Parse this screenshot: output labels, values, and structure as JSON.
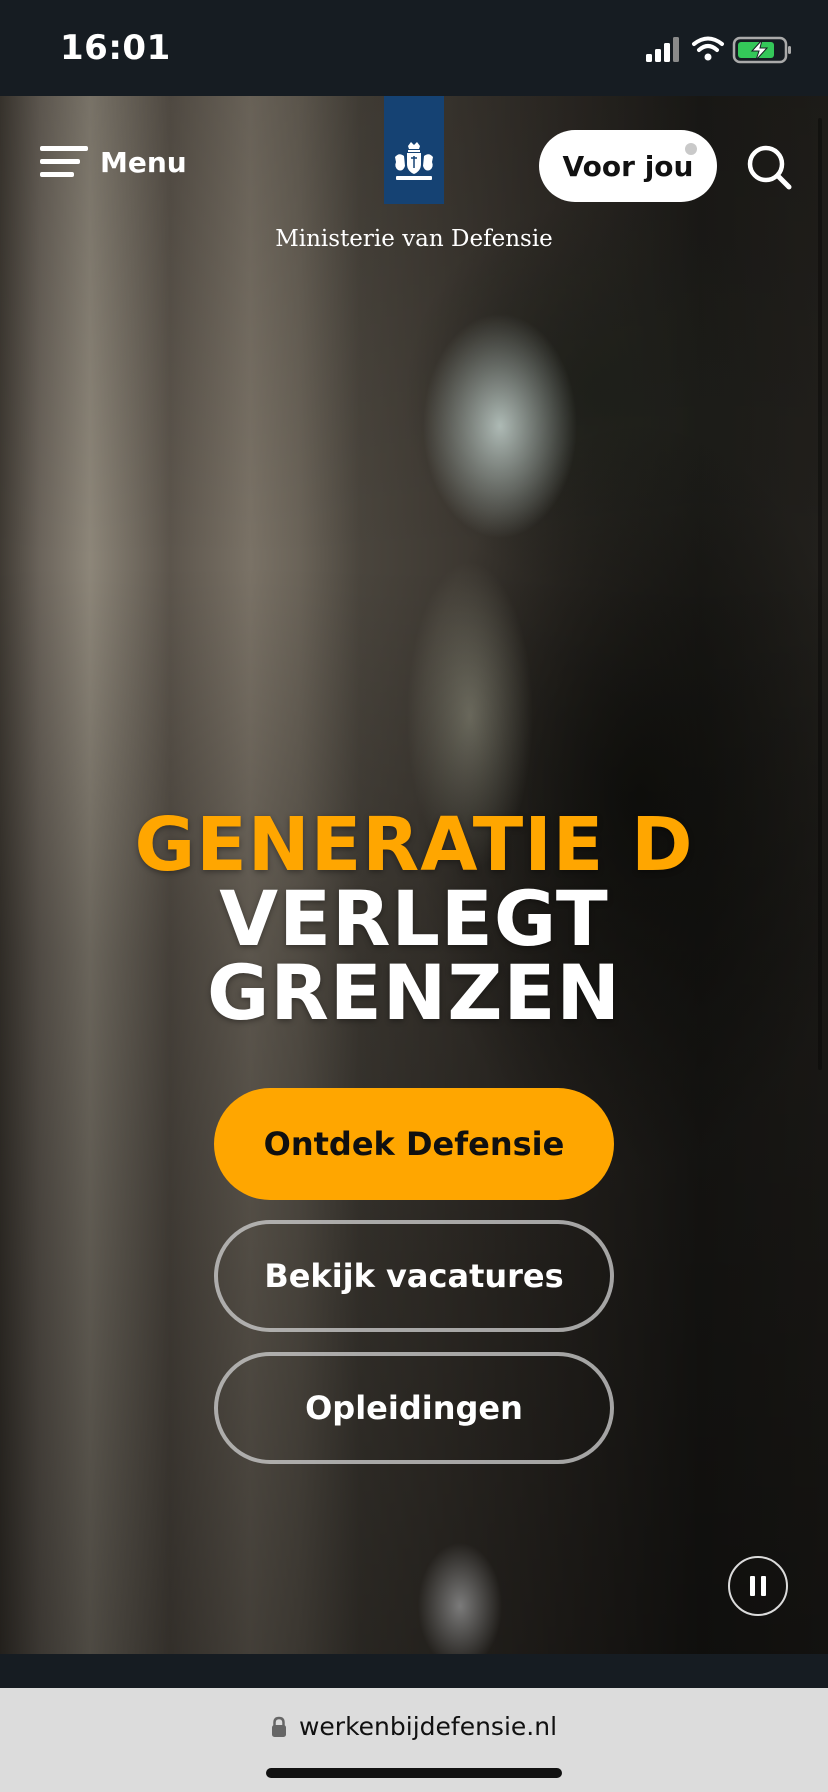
{
  "status_bar": {
    "time": "16:01",
    "icons": [
      "signal-icon",
      "wifi-icon",
      "battery-charging-icon"
    ]
  },
  "header": {
    "menu_label": "Menu",
    "logo_icon": "rijksoverheid-coat-of-arms-logo",
    "ministry_name": "Ministerie van Defensie",
    "voor_jou_label": "Voor jou",
    "search_icon": "search-icon"
  },
  "hero": {
    "headline_line1": "GENERATIE D",
    "headline_line2": "VERLEGT",
    "headline_line3": "GRENZEN",
    "primary_button": "Ontdek Defensie",
    "secondary_button": "Bekijk vacatures",
    "tertiary_button": "Opleidingen",
    "pause_icon": "pause-icon"
  },
  "browser": {
    "url": "werkenbijdefensie.nl",
    "lock_icon": "lock-icon"
  },
  "colors": {
    "accent": "#ffa600",
    "logo_blue": "#154273",
    "dark_bg": "#161c22"
  }
}
